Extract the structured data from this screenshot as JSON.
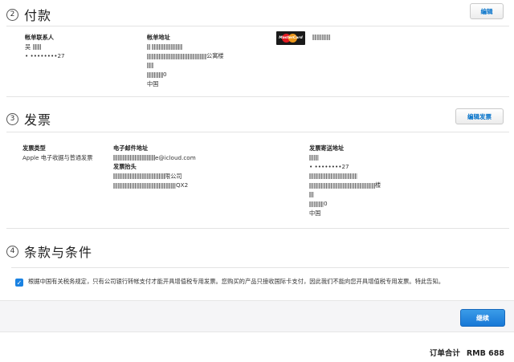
{
  "payment": {
    "step": "2",
    "title": "付款",
    "edit_label": "编辑",
    "contact_label": "帐单联系人",
    "contact_name": "吴",
    "contact_phone": "• ••••••••27",
    "address_label": "帐单地址",
    "address_line_suffix": "公寓楼",
    "address_zip_suffix": "0",
    "address_country": "中国",
    "card_brand": "MasterCard"
  },
  "invoice": {
    "step": "3",
    "title": "发票",
    "edit_label": "编辑发票",
    "type_label": "发票类型",
    "type_value": "Apple 电子收据与普通发票",
    "email_label": "电子邮件地址",
    "email_suffix": "e@icloud.com",
    "header_label": "发票抬头",
    "company_suffix": "限公司",
    "tax_suffix": "QX2",
    "mail_label": "发票寄送地址",
    "mail_phone": "• ••••••••27",
    "mail_line_suffix": "楼",
    "mail_zip_suffix": "0",
    "mail_country": "中国"
  },
  "terms": {
    "step": "4",
    "title": "条款与条件",
    "checked": true,
    "text": "根据中国有关税务规定，只有公司银行转帐支付才能开具增值税专用发票。您购买的产品只接收国际卡支付，因此我们不能向您开具增值税专用发票。特此告知。"
  },
  "footer": {
    "continue_label": "继续",
    "total_label": "订单合计",
    "total_value": "RMB 688"
  },
  "colors": {
    "accent": "#0070c9",
    "primary_button": "#1a82e2"
  }
}
